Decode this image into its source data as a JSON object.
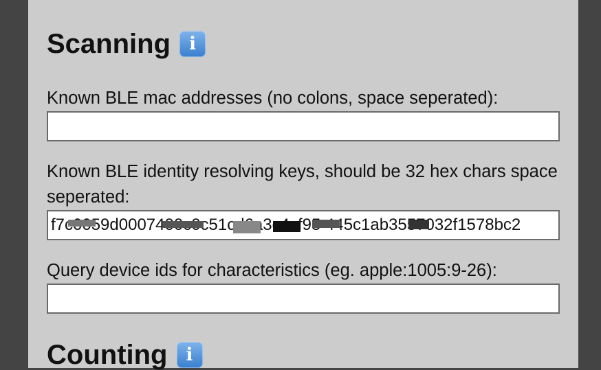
{
  "scanning": {
    "heading": "Scanning",
    "info_icon": "info-icon",
    "mac_label": "Known BLE mac addresses (no colons, space seperated):",
    "mac_value": "",
    "irk_label": "Known BLE identity resolving keys, should be 32 hex chars space seperated:",
    "irk_value": "f7c0059d0007400c0c51cd6a3c4cf95 445c1ab3557032f1578bc2",
    "query_label": "Query device ids for characteristics (eg. apple:1005:9-26):",
    "query_value": ""
  },
  "counting": {
    "heading": "Counting",
    "info_icon": "info-icon"
  },
  "colors": {
    "page_background": "#444444",
    "panel_background": "#cccccc",
    "input_border": "#6a6a6a",
    "info_icon": "#4a8ddb"
  }
}
